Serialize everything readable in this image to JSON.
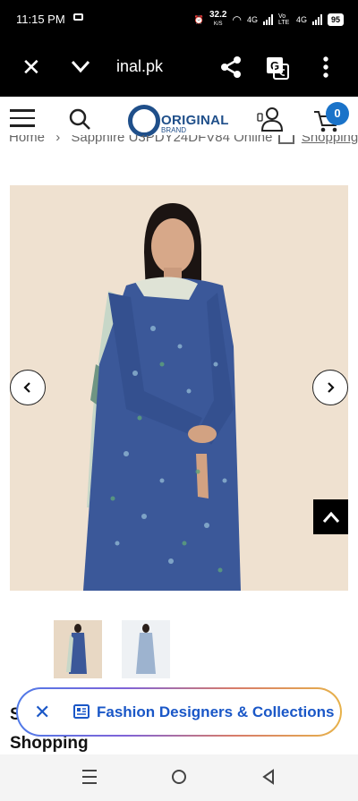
{
  "status_bar": {
    "time": "11:15 PM",
    "data_speed": "32.2",
    "data_unit": "K/S",
    "net1": "4G",
    "net2": "Vo LTE",
    "net3": "4G",
    "battery": "95"
  },
  "browser": {
    "url": "inal.pk",
    "icons": [
      "close-icon",
      "chevron-down-icon",
      "share-icon",
      "translate-icon",
      "more-vertical-icon"
    ]
  },
  "site_header": {
    "logo_text_main": "ORIGINAL",
    "logo_text_sub": "BRAND",
    "cart_count": "0",
    "icons": [
      "menu-icon",
      "search-icon",
      "user-icon",
      "cart-icon"
    ]
  },
  "breadcrumb": {
    "home": "Home",
    "separator": "›",
    "current": "Sapphire U3PDY24DFV84 Online",
    "current_suffix": "Shopping"
  },
  "product": {
    "title_start": "S",
    "title_line2": "Shopping"
  },
  "gallery": {
    "thumbnails": [
      "thumb-1",
      "thumb-2"
    ]
  },
  "chip": {
    "label": "Fashion Designers & Collections"
  },
  "colors": {
    "accent": "#1a73c9",
    "chip_text": "#1a57c7",
    "dress": "#3b5899",
    "background_photo": "#efe1d0"
  }
}
